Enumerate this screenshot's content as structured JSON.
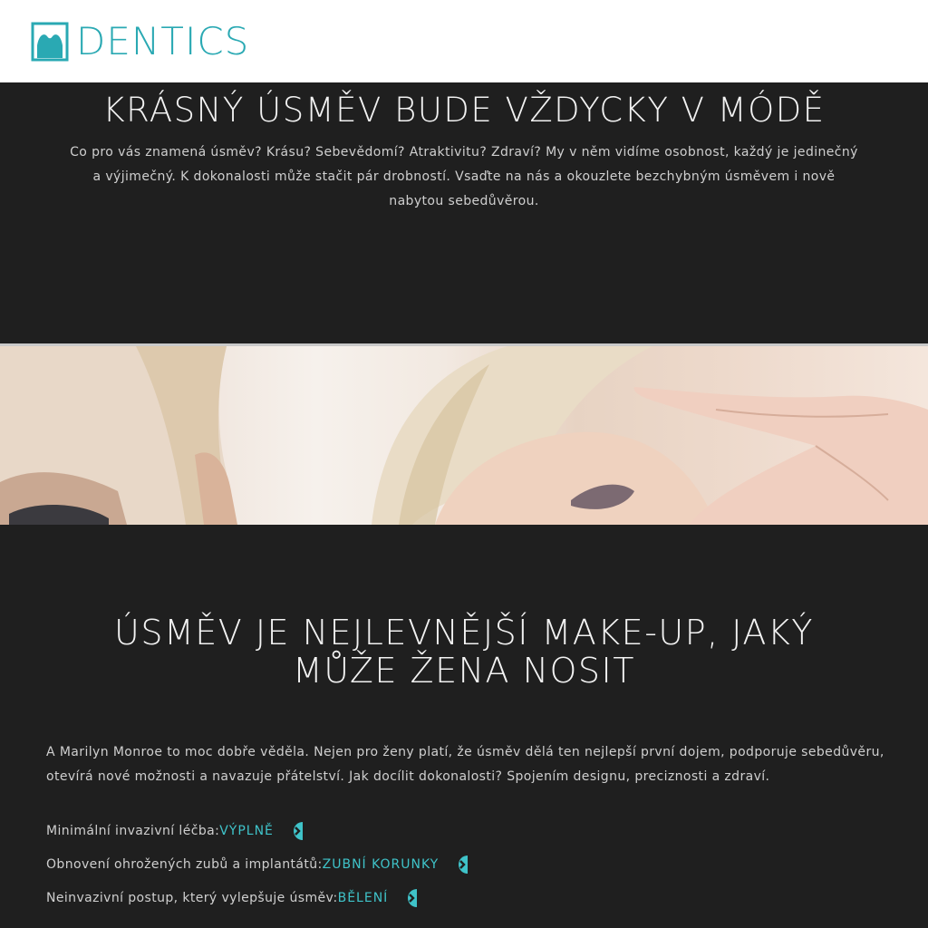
{
  "header": {
    "logo_text": "DENTICS",
    "brand_color": "#2aa9b3"
  },
  "hero": {
    "title": "KRÁSNÝ ÚSMĚV BUDE VŽDYCKY V MÓDĚ",
    "text": "Co pro vás znamená úsměv? Krásu? Sebevědomí? Atraktivitu? Zdraví? My v něm vidíme osobnost, každý je jedinečný a výjimečný. K dokonalosti může stačit pár drobností. Vsaďte na nás a okouzlete bezchybným úsměvem i nově nabytou sebedůvěrou."
  },
  "section2": {
    "title_line1": "ÚSMĚV JE NEJLEVNĚJŠÍ MAKE-UP, JAKÝ",
    "title_line2": "MŮŽE ŽENA NOSIT",
    "text": "A Marilyn Monroe to moc dobře věděla. Nejen pro ženy platí, že úsměv dělá ten nejlepší první dojem, podporuje sebedůvěru, otevírá nové možnosti a navazuje přátelství. Jak docílit dokonalosti? Spojením designu, preciznosti a zdraví."
  },
  "services": [
    {
      "label": "Minimální invazivní léčba:",
      "link": "VÝPLNĚ",
      "icon": "arrow-circle-icon"
    },
    {
      "label": "Obnovení ohrožených zubů a implantátů:",
      "link": "ZUBNÍ KORUNKY",
      "icon": "arrow-circle-icon"
    },
    {
      "label": "Neinvazivní postup, který vylepšuje úsměv:",
      "link": "BĚLENÍ",
      "icon": "arrow-circle-icon"
    }
  ],
  "colors": {
    "background": "#1f1f1f",
    "accent": "#3fc3c9",
    "heading": "#f2f2f2",
    "body_text": "#cfcfcf"
  }
}
